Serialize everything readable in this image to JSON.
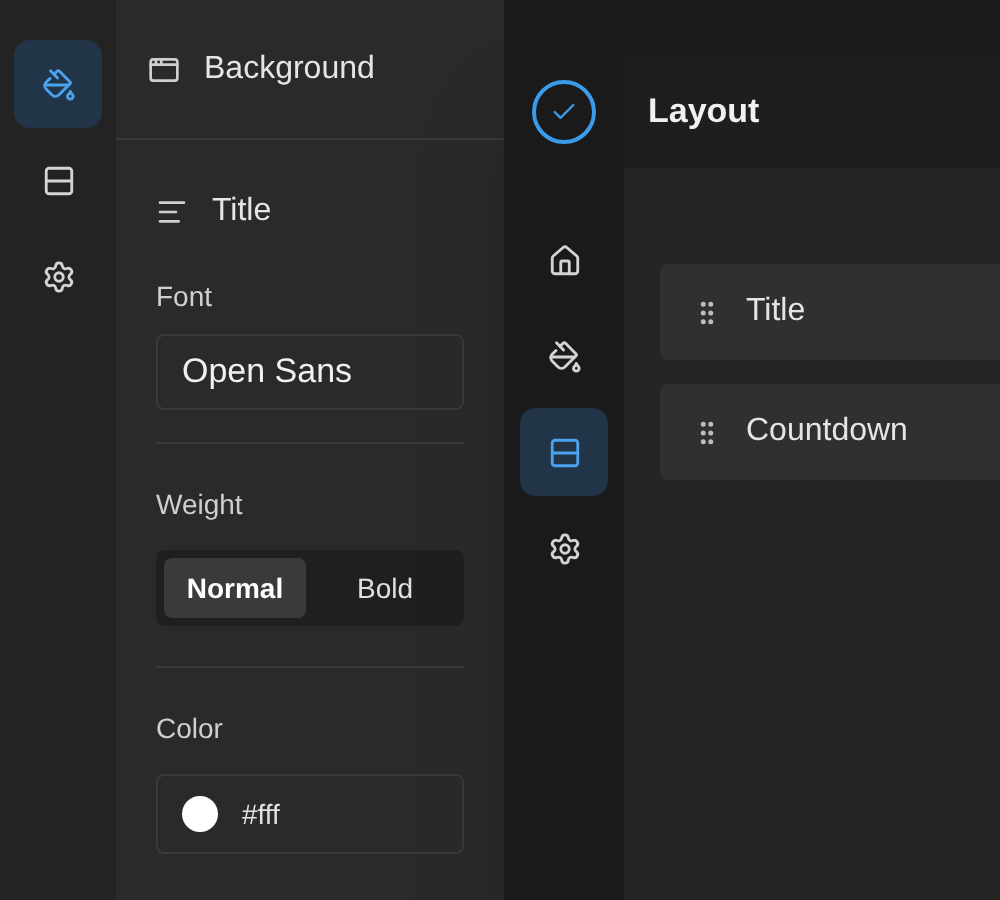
{
  "editor": {
    "nav": [
      {
        "kind": "paint",
        "selected": true
      },
      {
        "kind": "rows",
        "selected": false
      },
      {
        "kind": "gear",
        "selected": false
      }
    ],
    "header": "Background",
    "section": "Title",
    "font_label": "Font",
    "font_value": "Open Sans",
    "weight_label": "Weight",
    "weights": [
      {
        "label": "Normal",
        "selected": true
      },
      {
        "label": "Bold",
        "selected": false
      }
    ],
    "color_label": "Color",
    "color_value": "#fff",
    "color": "#ffffff"
  },
  "layout": {
    "nav": [
      {
        "kind": "home",
        "selected": false
      },
      {
        "kind": "paint",
        "selected": false
      },
      {
        "kind": "rows",
        "selected": true
      },
      {
        "kind": "gear",
        "selected": false
      }
    ],
    "title": "Layout",
    "items": [
      "Title",
      "Countdown"
    ]
  }
}
